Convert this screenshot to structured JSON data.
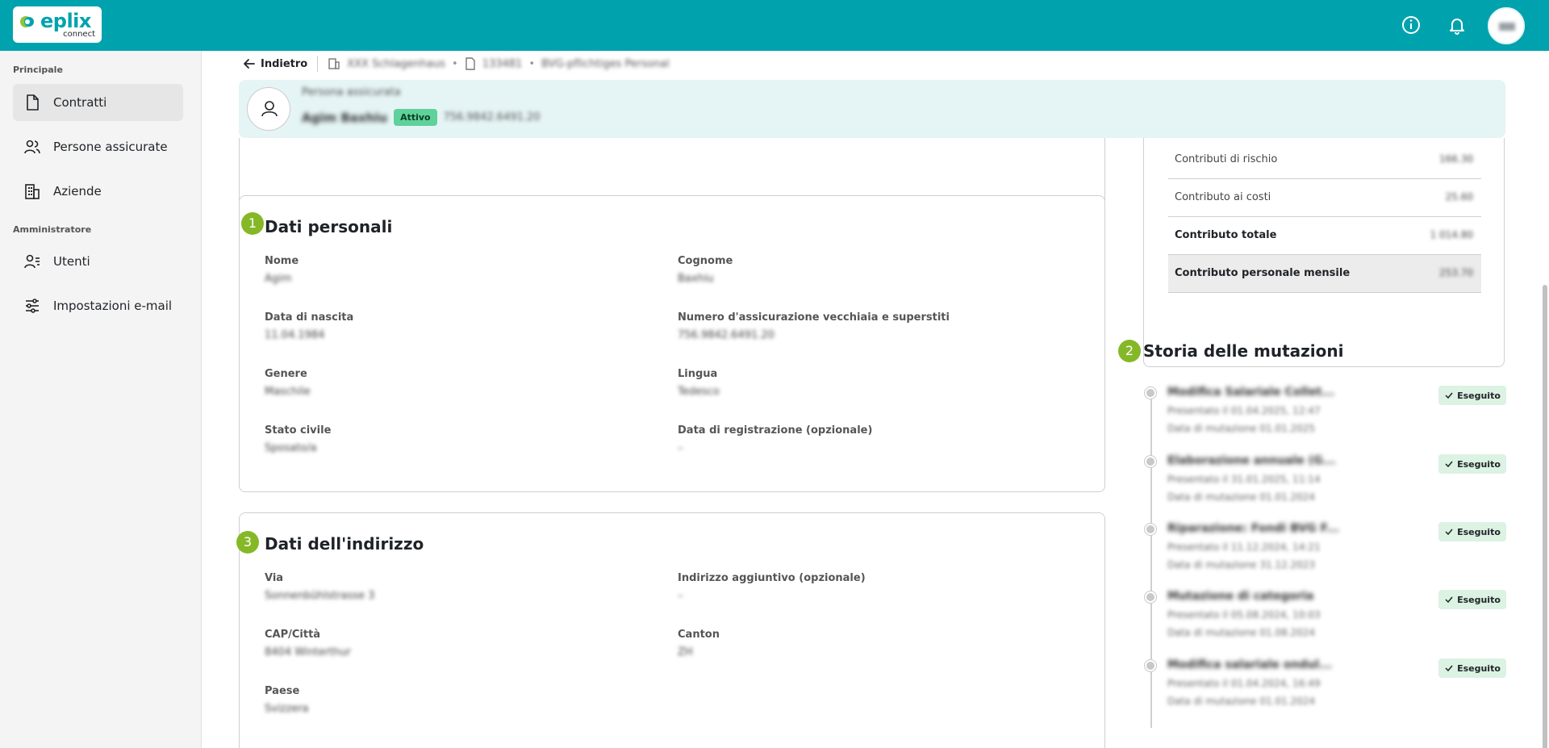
{
  "app": {
    "logo_text": "eplix",
    "logo_sub": "connect"
  },
  "topbar": {
    "avatar_initials": "ma"
  },
  "sidebar": {
    "section_main": "Principale",
    "section_admin": "Amministratore",
    "items": [
      {
        "label": "Contratti",
        "icon": "document-icon"
      },
      {
        "label": "Persone assicurate",
        "icon": "people-icon"
      },
      {
        "label": "Aziende",
        "icon": "building-icon"
      },
      {
        "label": "Utenti",
        "icon": "users-icon"
      },
      {
        "label": "Impostazioni e-mail",
        "icon": "settings-sliders-icon"
      }
    ]
  },
  "breadcrumb": {
    "back_label": "Indietro",
    "company": "XXX Schlagenhaus",
    "contract": "133481",
    "plan": "BVG-pflichtiges Personal"
  },
  "person": {
    "role_line": "Persona assicurata",
    "name": "Agim Baxhiu",
    "status": "Attivo",
    "ahv": "756.9842.6491.20"
  },
  "personal": {
    "step": "1",
    "title": "Dati personali",
    "fields": [
      {
        "label": "Nome",
        "value": "Agim"
      },
      {
        "label": "Cognome",
        "value": "Baxhiu"
      },
      {
        "label": "Data di nascita",
        "value": "11.04.1984"
      },
      {
        "label": "Numero d'assicurazione vecchiaia e superstiti",
        "value": "756.9842.6491.20"
      },
      {
        "label": "Genere",
        "value": "Maschile"
      },
      {
        "label": "Lingua",
        "value": "Tedesco"
      },
      {
        "label": "Stato civile",
        "value": "Sposato/a"
      },
      {
        "label": "Data di registrazione (opzionale)",
        "value": "–"
      }
    ]
  },
  "address": {
    "step": "3",
    "title": "Dati dell'indirizzo",
    "fields": [
      {
        "label": "Via",
        "value": "Sonnenbühlstrasse 3"
      },
      {
        "label": "Indirizzo aggiuntivo (opzionale)",
        "value": "–"
      },
      {
        "label": "CAP/Città",
        "value": "8404 Winterthur"
      },
      {
        "label": "Canton",
        "value": "ZH"
      },
      {
        "label": "Paese",
        "value": "Svizzera"
      }
    ]
  },
  "contributions": {
    "rows": [
      {
        "label": "Contributi di rischio",
        "value": "166.30"
      },
      {
        "label": "Contributo ai costi",
        "value": "25.60"
      },
      {
        "label": "Contributo totale",
        "value": "1 014.80"
      },
      {
        "label": "Contributo personale mensile",
        "value": "253.70"
      }
    ]
  },
  "history": {
    "step": "2",
    "title": "Storia delle mutazioni",
    "badge": "Eseguito",
    "items": [
      {
        "title": "Modifica Salariale Collet...",
        "line2": "Presentato il 01.04.2025, 12:47",
        "line3": "Data di mutazione 01.01.2025"
      },
      {
        "title": "Elaborazione annuale (G...",
        "line2": "Presentato il 31.01.2025, 11:14",
        "line3": "Data di mutazione 01.01.2024"
      },
      {
        "title": "Riparazione: Fondi BVG F...",
        "line2": "Presentato il 11.12.2024, 14:21",
        "line3": "Data di mutazione 31.12.2023"
      },
      {
        "title": "Mutazione di categoria",
        "line2": "Presentato il 05.08.2024, 10:03",
        "line3": "Data di mutazione 01.08.2024"
      },
      {
        "title": "Modifica salariale ondul...",
        "line2": "Presentato il 01.04.2024, 16:49",
        "line3": "Data di mutazione 01.01.2024"
      }
    ]
  }
}
